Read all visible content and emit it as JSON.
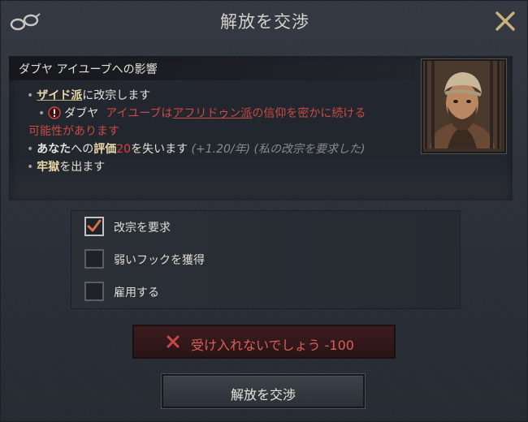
{
  "title": "解放を交渉",
  "info": {
    "header": "ダブヤ アイユーブへの影響",
    "line1": {
      "faith": "ザイド派",
      "rest": "に改宗します"
    },
    "line2": {
      "name": "ダブヤ",
      "name2": "アイユーブは",
      "faith": "アフリドゥン派",
      "rest": "の信仰を密かに続ける",
      "cont": "可能性があります"
    },
    "line3": {
      "you": "あなた",
      "to": "への",
      "opinion": "評価",
      "amount": "20",
      "lose": "を失います",
      "rate": "(+1.20/年)",
      "reason": "(私の改宗を要求した)"
    },
    "line4": {
      "text": "牢獄",
      "rest": "を出ます"
    }
  },
  "options": [
    {
      "label": "改宗を要求",
      "checked": true
    },
    {
      "label": "弱いフックを獲得",
      "checked": false
    },
    {
      "label": "雇用する",
      "checked": false
    }
  ],
  "verdict": {
    "text": "受け入れないでしょう",
    "value": "-100"
  },
  "action_label": "解放を交渉",
  "colors": {
    "negative": "#c94a45",
    "gold": "#e8d9a8",
    "accent_red": "#e0403a"
  }
}
